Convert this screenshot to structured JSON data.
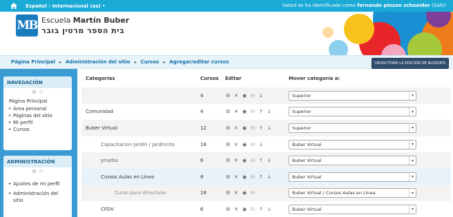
{
  "topbar": {
    "language": "Español - Internacional (es)",
    "login_prefix": "Usted se ha identificado como ",
    "user_name": "fernando pinzon schneider",
    "logout": " (Salir)"
  },
  "header": {
    "logo_text": "MB",
    "school_prefix": "Escuela ",
    "school_name": "Martín Buber",
    "hebrew_name": "בית הספר מרטין בובר"
  },
  "breadcrumb": [
    "Página Principal",
    "Administración del sitio",
    "Cursos",
    "Agregar/editar cursos"
  ],
  "edit_button": "DESACTIVAR LA EDICIÓN DE BLOQUES",
  "nav_block": {
    "title": "NAVEGACIÓN",
    "root": "Página Principal",
    "items": [
      "Área personal",
      "Páginas del sitio",
      "Mi perfil",
      "Cursos"
    ]
  },
  "admin_block": {
    "title": "ADMINISTRACIÓN",
    "items": [
      "Ajustes de mi perfil",
      "Administración del sitio"
    ]
  },
  "table": {
    "headers": {
      "categories": "Categorías",
      "courses": "Cursos",
      "edit": "Editar",
      "move": "Mover categoría a:"
    },
    "rows": [
      {
        "name": "",
        "courses": "4",
        "target": "Superior"
      },
      {
        "name": "Comunidad",
        "courses": "4",
        "target": "Superior"
      },
      {
        "name": "Buber Virtual",
        "courses": "12",
        "target": "Superior"
      },
      {
        "name": "Capacitacion Jardín / Jardincito",
        "courses": "18",
        "target": "Buber Virtual"
      },
      {
        "name": "prueba",
        "courses": "6",
        "target": "Buber Virtual"
      },
      {
        "name": "Cursos Aulas en Línea",
        "courses": "8",
        "target": "Buber Virtual"
      },
      {
        "name": "Curso para directivos",
        "courses": "18",
        "target": "Buber Virtual / Cursos Aulas en Línea"
      },
      {
        "name": "CFDV",
        "courses": "6",
        "target": "Buber Virtual"
      }
    ]
  },
  "colors": {
    "topbar": "#1ba9d6",
    "sidebar": "#3a9bd4",
    "link": "#1670a8",
    "button": "#2f4d6e"
  }
}
